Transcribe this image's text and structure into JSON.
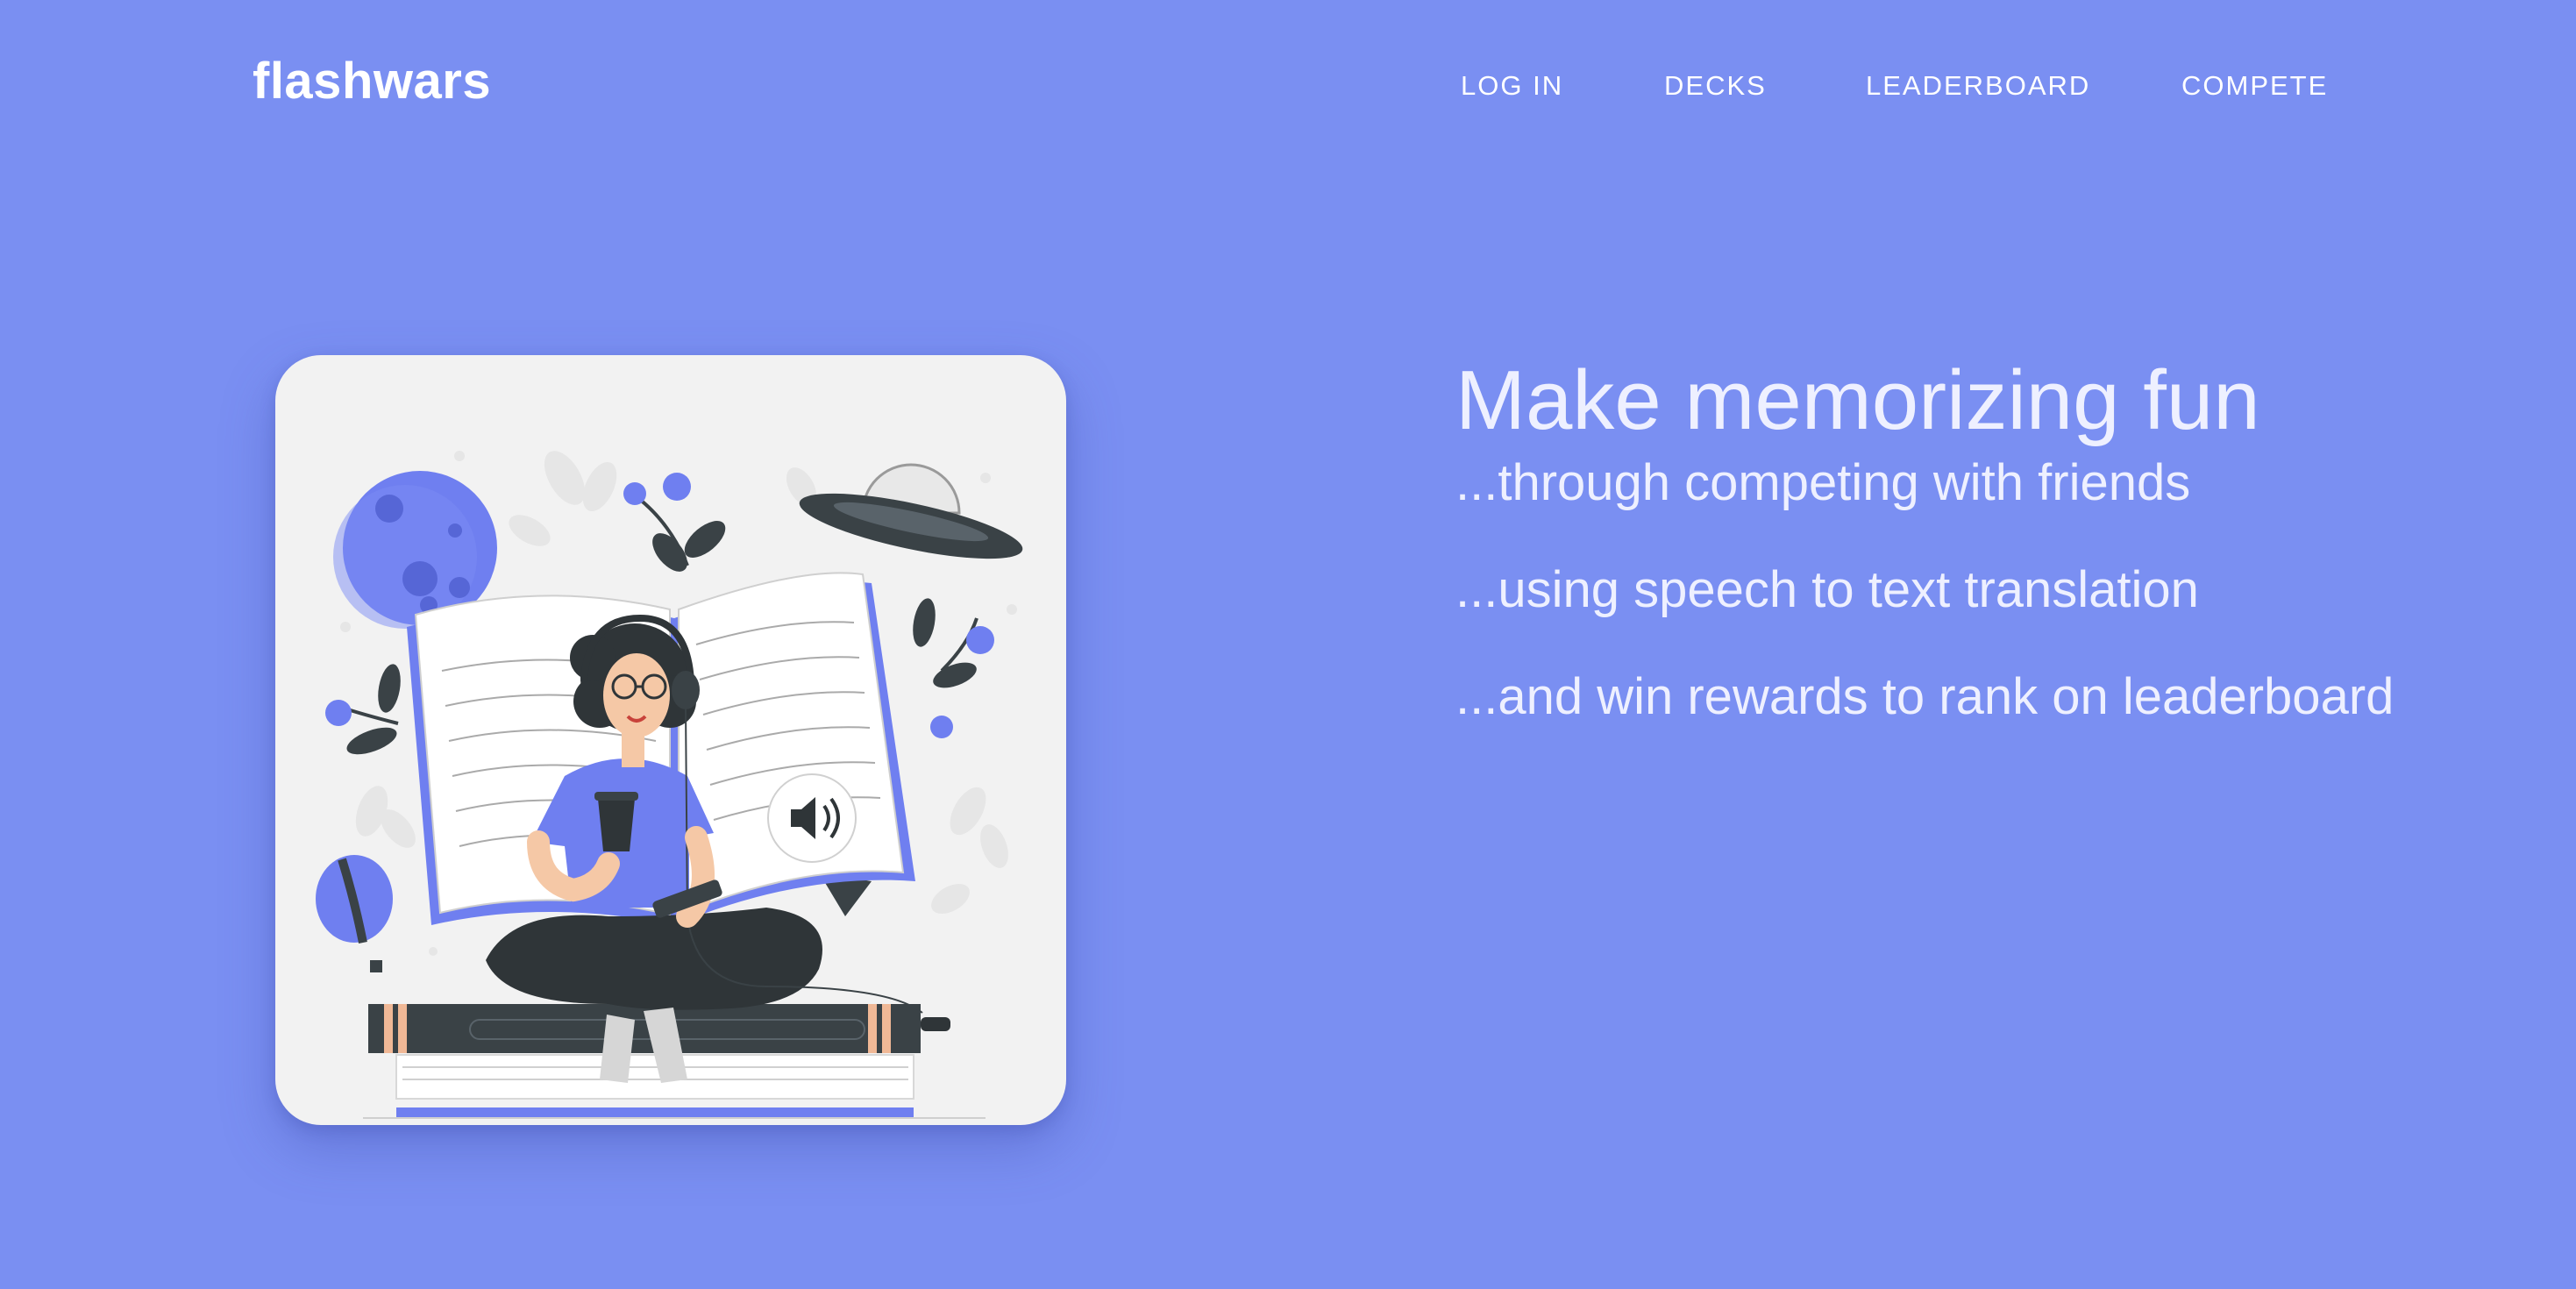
{
  "brand": {
    "name": "flashwars"
  },
  "nav": {
    "items": [
      {
        "label": "LOG IN"
      },
      {
        "label": "DECKS"
      },
      {
        "label": "LEADERBOARD"
      },
      {
        "label": "COMPETE"
      }
    ]
  },
  "hero": {
    "headline": "Make memorizing fun",
    "taglines": [
      "...through competing with friends",
      "...using speech to text translation",
      "...and win rewards to rank on leaderboard"
    ],
    "illustration": {
      "icons": [
        "moon-icon",
        "ufo-icon",
        "flower-icon",
        "hot-air-balloon-icon",
        "open-book-icon",
        "headphones-icon",
        "coffee-cup-icon",
        "phone-icon",
        "speaker-icon",
        "book-stack-icon"
      ]
    }
  },
  "colors": {
    "background": "#7a8ff2",
    "card": "#f2f2f2",
    "accent": "#6f7ff0",
    "dark": "#2f3538",
    "text": "#eef0ff"
  }
}
